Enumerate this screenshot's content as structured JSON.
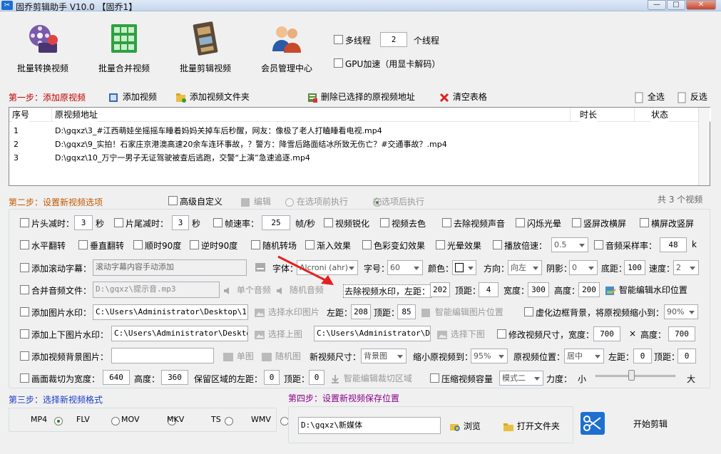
{
  "window": {
    "title": "固乔剪辑助手 V10.0 【固乔1】",
    "min": "—",
    "max": "□",
    "close": "✕"
  },
  "top_buttons": [
    "批量转换视频",
    "批量合并视频",
    "批量剪辑视频",
    "会员管理中心"
  ],
  "threads": {
    "multi_label": "多线程",
    "count": "2",
    "unit": "个线程",
    "gpu_label": "GPU加速（用显卡解码）"
  },
  "step1": {
    "title": "第一步：添加原视频",
    "add_video": "添加视频",
    "add_folder": "添加视频文件夹",
    "delete_selected": "删除已选择的原视频地址",
    "clear_table": "清空表格",
    "select_all": "全选",
    "invert": "反选"
  },
  "table": {
    "headers": [
      "序号",
      "原视频地址",
      "时长",
      "状态"
    ],
    "rows": [
      {
        "no": "1",
        "path": "D:\\gqxz\\3_#江西萌娃坐摇摇车睡着妈妈关掉车后秒醒，网友：像极了老人打瞌睡看电视.mp4",
        "duration": "",
        "status": ""
      },
      {
        "no": "2",
        "path": "D:\\gqxz\\9_实拍！石家庄京港澳高速20余车连环事故，？警方：降雪后路面结冰所致无伤亡？#交通事故？.mp4",
        "duration": "",
        "status": ""
      },
      {
        "no": "3",
        "path": "D:\\gqxz\\10_万宁一男子无证驾驶被查后逃跑，交警“上演”急速追逐.mp4",
        "duration": "",
        "status": ""
      }
    ],
    "count_text": "共 3 个视频"
  },
  "step2": {
    "title": "第二步：设置新视频选项",
    "advanced": "高级自定义",
    "edit": "编辑",
    "before": "在选项前执行",
    "after": "在选项后执行"
  },
  "row1": {
    "head_cut": "片头减时：",
    "head_val": "3",
    "sec1": "秒",
    "tail_cut": "片尾减时：",
    "tail_val": "3",
    "sec2": "秒",
    "fps": "帧速率：",
    "fps_val": "25",
    "fps_unit": "帧/秒",
    "sharpen": "视频锐化",
    "decolor": "视频去色",
    "remove_audio": "去除视频声音",
    "flash": "闪烁光晕",
    "v2h": "竖屏改横屏",
    "h2v": "横屏改竖屏"
  },
  "row2": {
    "hflip": "水平翻转",
    "vflip": "垂直翻转",
    "rot90": "顺时90度",
    "rot_ccw": "逆时90度",
    "random_trans": "随机转场",
    "fadein": "渐入效果",
    "color_fx": "色彩变幻效果",
    "halo": "光晕效果",
    "speed": "播放倍速：",
    "speed_val": "0.5",
    "sample_rate": "音频采样率：",
    "sample_val": "48",
    "sample_unit": "k"
  },
  "row3": {
    "scroll_sub": "添加滚动字幕：",
    "scroll_placeholder": "滚动字幕内容手动添加",
    "font": "字体：",
    "font_val": "Alcroni (ahr)",
    "size": "字号：",
    "size_val": "60",
    "color": "颜色：",
    "direction": "方向：",
    "direction_val": "向左",
    "shadow": "阴影：",
    "shadow_val": "0",
    "bottom": "底距：",
    "bottom_val": "100",
    "speed": "速度：",
    "speed_val": "2"
  },
  "row4": {
    "merge_audio": "合并音频文件：",
    "audio_path": "D:\\gqxz\\提示音.mp3",
    "single_audio": "单个音频",
    "random_audio": "随机音频",
    "remove_wm": "去除视频水印，左距：",
    "left_val": "202",
    "top": "顶距：",
    "top_val": "4",
    "width": "宽度：",
    "width_val": "300",
    "height": "高度：",
    "height_val": "200",
    "smart_wm": "智能编辑水印位置"
  },
  "row5": {
    "img_wm": "添加图片水印：",
    "img_path": "C:\\Users\\Administrator\\Desktop\\111.j",
    "pick_img": "选择水印图片",
    "left": "左距：",
    "left_val": "208",
    "top": "顶距：",
    "top_val": "85",
    "smart_img": "智能编辑图片位置",
    "blur_bg": "虚化边框背景，将原视频缩小到：",
    "blur_val": "90%"
  },
  "row6": {
    "updown_wm": "添加上下图片水印：",
    "up_path": "C:\\Users\\Administrator\\Desktop\\i",
    "pick_up": "选择上图",
    "down_path": "C:\\Users\\Administrator\\Desk",
    "pick_down": "选择下图",
    "resize": "修改视频尺寸，宽度：",
    "w_val": "700",
    "x": "×",
    "h_label": "高度：",
    "h_val": "700"
  },
  "row7": {
    "bg_img": "添加视频背景图片：",
    "single_img": "单图",
    "random_img": "随机图",
    "new_size": "新视频尺寸：",
    "new_size_val": "背景图",
    "shrink": "缩小原视频到：",
    "shrink_val": "95%",
    "pos": "原视频位置：",
    "pos_val": "居中",
    "left": "左距：",
    "left_val": "0",
    "top": "顶距：",
    "top_val": "0"
  },
  "row8": {
    "crop": "画面裁切为宽度：",
    "crop_w": "640",
    "crop_h_label": "高度：",
    "crop_h": "360",
    "keep_left": "保留区域的左距：",
    "keep_left_val": "0",
    "top": "顶距：",
    "top_val": "0",
    "smart_crop": "智能编辑裁切区域",
    "compress": "压缩视频容量",
    "mode_val": "模式二",
    "strength": "力度：",
    "small": "小",
    "large": "大"
  },
  "compress_level": 0.45,
  "step3": {
    "title": "第三步：选择新视频格式",
    "formats": [
      "MP4",
      "FLV",
      "MOV",
      "MKV",
      "TS",
      "WMV"
    ]
  },
  "step4": {
    "title": "第四步：设置新视频保存位置",
    "path": "D:\\gqxz\\新媒体",
    "browse": "浏览",
    "open_folder": "打开文件夹"
  },
  "start": "开始剪辑"
}
